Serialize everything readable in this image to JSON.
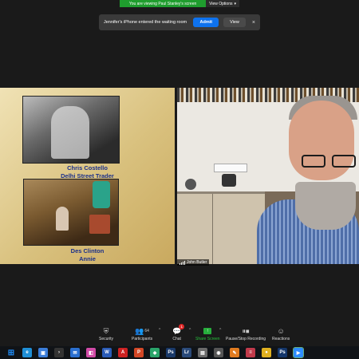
{
  "share_bar": {
    "message": "You are viewing Paul Stanley's screen",
    "view_options": "View Options",
    "caret": "▾"
  },
  "waiting_room": {
    "message": "Jennifer's iPhone entered the waiting room",
    "admit": "Admit",
    "view": "View",
    "close": "×"
  },
  "shared_screen": {
    "captions": [
      {
        "name": "Chris Costello",
        "title": "Delhi Street Trader"
      },
      {
        "name": "Des Clinton",
        "title": "Annie"
      }
    ]
  },
  "video": {
    "participant_name": "John Butler"
  },
  "toolbar": {
    "security": "Security",
    "participants": "Participants",
    "participants_count": "64",
    "chat": "Chat",
    "chat_badge": "1",
    "share_screen": "Share Screen",
    "pause_recording": "Pause/Stop Recording",
    "reactions": "Reactions",
    "caret": "^"
  },
  "taskbar": {
    "apps": [
      {
        "icon": "windows-start-icon",
        "glyph": "⊞",
        "color": "#1e90ff"
      },
      {
        "icon": "edge-icon",
        "glyph": "e",
        "color": "#1f8fd6"
      },
      {
        "icon": "store-icon",
        "glyph": "▣",
        "color": "#3b7dd8"
      },
      {
        "icon": "terminal-icon",
        "glyph": "›",
        "color": "#333"
      },
      {
        "icon": "mail-icon",
        "glyph": "✉",
        "color": "#2a6fd0"
      },
      {
        "icon": "photos-icon",
        "glyph": "◧",
        "color": "#d04aa6"
      },
      {
        "icon": "word-icon",
        "glyph": "W",
        "color": "#2b5cb8"
      },
      {
        "icon": "acrobat-icon",
        "glyph": "A",
        "color": "#c22"
      },
      {
        "icon": "powerpoint-icon",
        "glyph": "P",
        "color": "#d24726"
      },
      {
        "icon": "maps-icon",
        "glyph": "◆",
        "color": "#2aa56a"
      },
      {
        "icon": "photoshop-icon",
        "glyph": "Ps",
        "color": "#1a3a6a"
      },
      {
        "icon": "lightroom-icon",
        "glyph": "Lr",
        "color": "#2a4a7a"
      },
      {
        "icon": "files-icon",
        "glyph": "▤",
        "color": "#6a6a6a"
      },
      {
        "icon": "camera-icon",
        "glyph": "◉",
        "color": "#555"
      },
      {
        "icon": "paint-icon",
        "glyph": "✎",
        "color": "#e07b20"
      },
      {
        "icon": "layers-icon",
        "glyph": "≡",
        "color": "#c03a4a"
      },
      {
        "icon": "chrome-icon",
        "glyph": "●",
        "color": "#e0b020"
      },
      {
        "icon": "photoshop2-icon",
        "glyph": "Ps",
        "color": "#14366a"
      },
      {
        "icon": "zoom-icon",
        "glyph": "▶",
        "color": "#2d8cff"
      }
    ]
  }
}
